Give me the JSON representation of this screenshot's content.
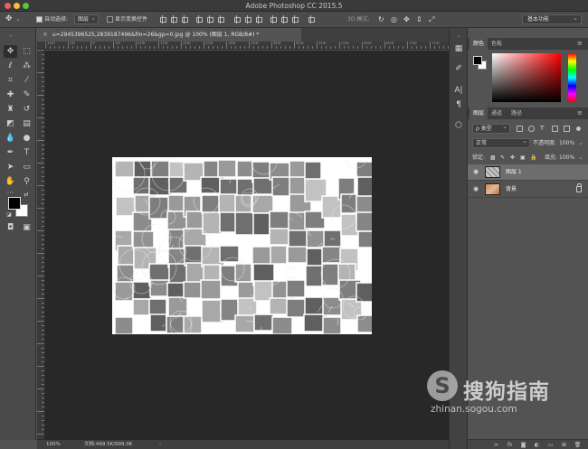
{
  "window": {
    "title": "Adobe Photoshop CC 2015.5"
  },
  "options_bar": {
    "auto_select_label": "自动选择:",
    "auto_select_target": "图层",
    "show_transform_label": "显示变换控件",
    "mode_3d_label": "3D 模式:",
    "workspace": "基本功能"
  },
  "document": {
    "tab_title": "u=2945396525,2839187496&fm=26&gp=0.jpg @ 100% (图层 1, RGB/8#) *",
    "ruler_labels": [
      "100",
      "50",
      "0",
      "50",
      "100",
      "150",
      "200",
      "250",
      "300",
      "350",
      "400",
      "450",
      "500",
      "550",
      "600",
      "650",
      "700",
      "750",
      "800",
      "850"
    ]
  },
  "status": {
    "zoom": "100%",
    "doc_info": "文档:499.5K/999.0K"
  },
  "color_panel": {
    "tabs": [
      "颜色",
      "色板"
    ],
    "colors": {
      "foreground": "#000000",
      "background": "#ffffff"
    }
  },
  "layers_panel": {
    "tabs": [
      "图层",
      "通道",
      "路径"
    ],
    "filter_label": "ρ 类型",
    "blend_mode": "正常",
    "opacity_label": "不透明度:",
    "opacity_value": "100%",
    "lock_label": "锁定:",
    "fill_label": "填充:",
    "fill_value": "100%",
    "layers": [
      {
        "name": "图层 1",
        "selected": true
      },
      {
        "name": "背景",
        "selected": false
      }
    ]
  },
  "watermark": {
    "logo_letter": "S",
    "brand": "搜狗指南",
    "url": "zhinan.sogou.com"
  }
}
